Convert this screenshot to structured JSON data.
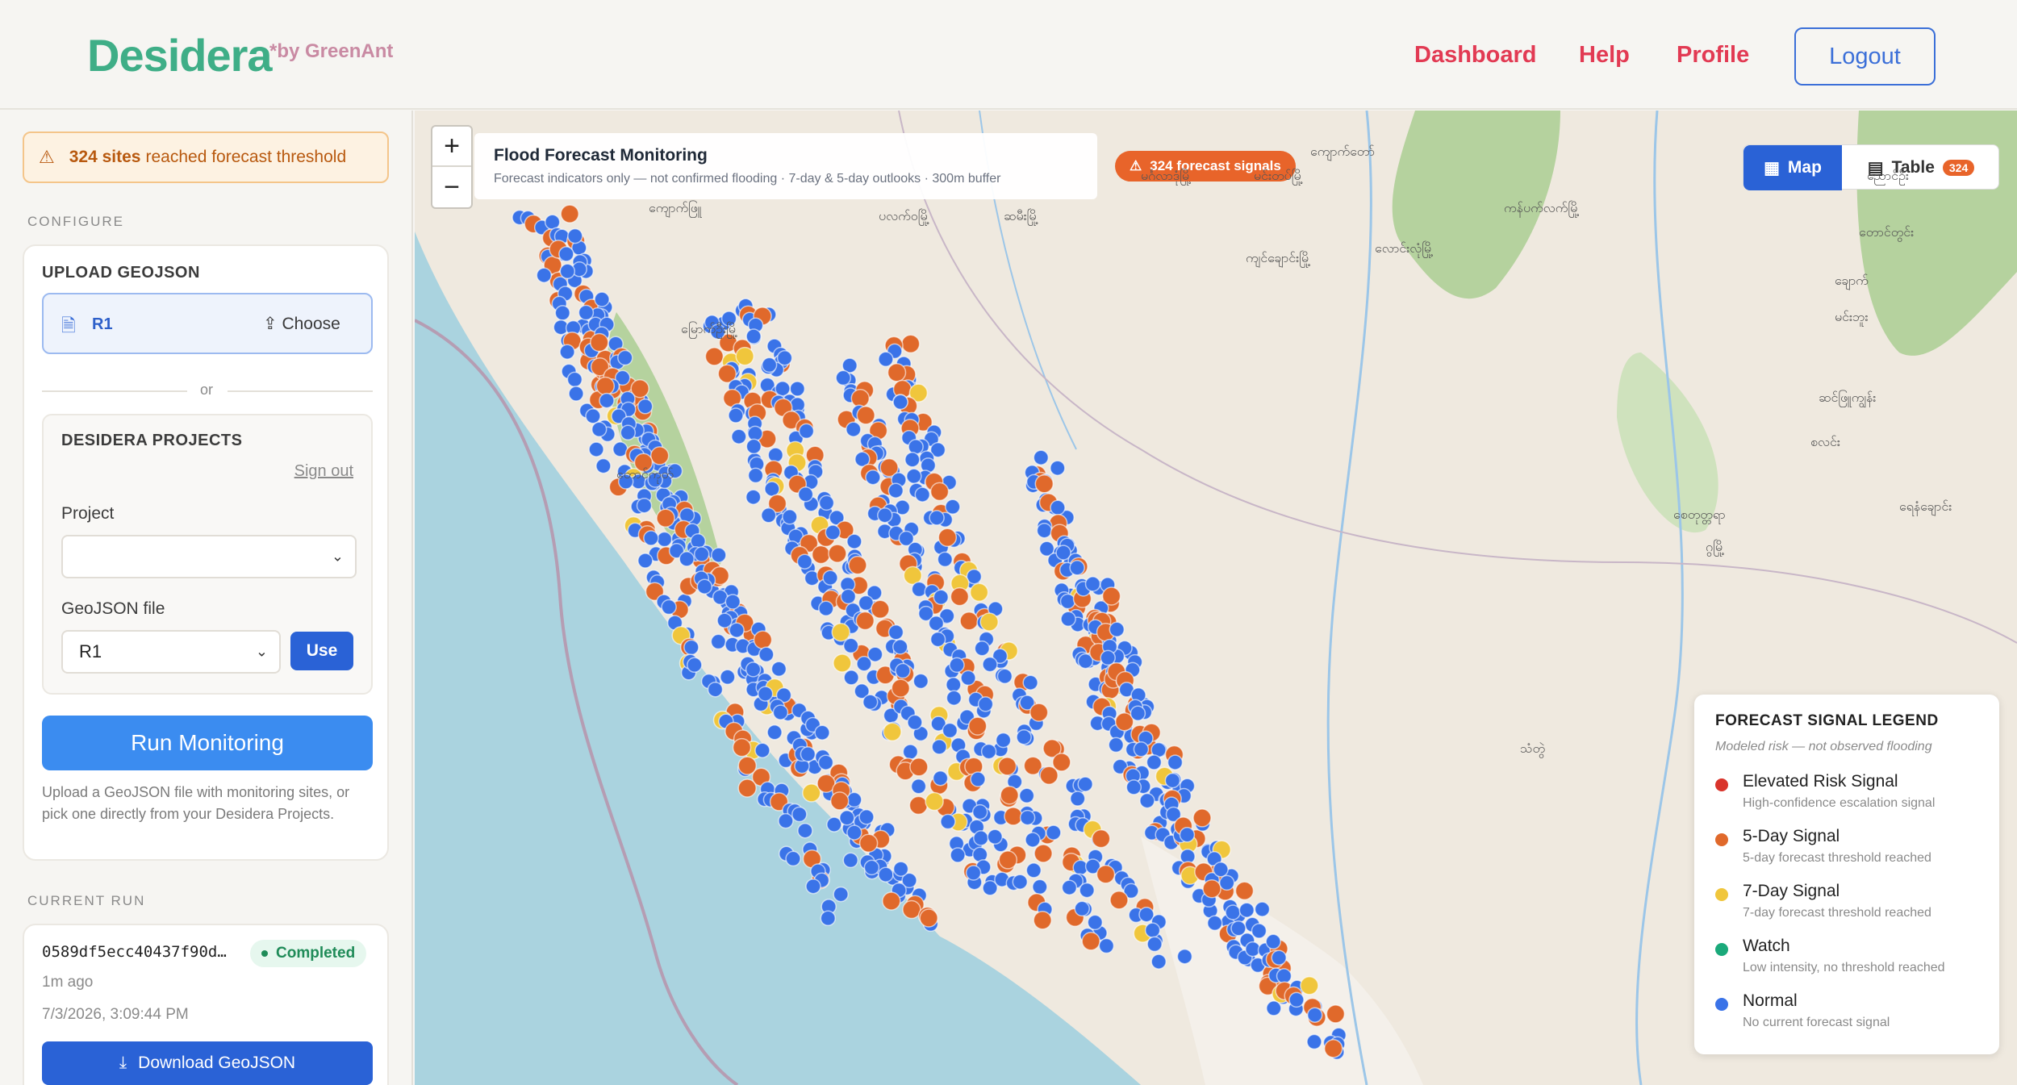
{
  "header": {
    "logo": "Desidera",
    "logo_sub": "*by GreenAnt",
    "nav": [
      "Dashboard",
      "Help",
      "Profile"
    ],
    "logout": "Logout"
  },
  "sidebar": {
    "alert": {
      "icon": "warning-icon",
      "count_text": "324 sites",
      "text": "reached forecast threshold"
    },
    "configure_label": "CONFIGURE",
    "upload": {
      "title": "UPLOAD GEOJSON",
      "file_name": "R1",
      "choose_label": "Choose",
      "or_label": "or"
    },
    "projects": {
      "title": "DESIDERA PROJECTS",
      "sign_out": "Sign out",
      "project_label": "Project",
      "project_value": "",
      "geojson_label": "GeoJSON file",
      "geojson_value": "R1",
      "use_label": "Use"
    },
    "run_button": "Run Monitoring",
    "help_text": "Upload a GeoJSON file with monitoring sites, or pick one directly from your Desidera Projects.",
    "current_run_label": "CURRENT RUN",
    "current_run": {
      "id": "0589df5ecc40437f90d…",
      "status": "Completed",
      "ago": "1m ago",
      "timestamp": "7/3/2026, 3:09:44 PM",
      "download_label": "Download GeoJSON"
    }
  },
  "map": {
    "title": "Flood Forecast Monitoring",
    "subtitle": "Forecast indicators only — not confirmed flooding · 7-day & 5-day outlooks · 300m buffer",
    "signals_pill": "324 forecast signals",
    "zoom_in": "+",
    "zoom_out": "−",
    "view_map": "Map",
    "view_table": "Table",
    "table_count": "324",
    "colors": {
      "elevated": "#d9342b",
      "five_day": "#e0692b",
      "seven_day": "#f0c63c",
      "watch": "#1aa97a",
      "normal": "#3a73e8"
    },
    "place_labels": [
      "ကျောက်တော်",
      "မင်းတပ်မြို့",
      "ပလက်ဝမြို့",
      "ဆမီးမြို့",
      "မင်္ဂလာဒုံမြို့",
      "ကျင်ချောင်းမြို့",
      "လောင်းလုံမြို့",
      "ကန်ပက်လက်မြို့",
      "ညောင်ဦး",
      "တောင်တွင်း",
      "ချောက်",
      "မင်းဘူး",
      "ဆင်ဖြူကျွန်း",
      "စလင်း",
      "စေတုတ္တရာ",
      "ရေနံချောင်း",
      "မြောက်ဦးမြို့",
      "ကျောက်ဖြူ",
      "တောင်ကုတ်",
      "ဂွမြို့",
      "သံတွဲ"
    ]
  },
  "legend": {
    "title": "FORECAST SIGNAL LEGEND",
    "subtitle": "Modeled risk — not observed flooding",
    "items": [
      {
        "name": "Elevated Risk Signal",
        "desc": "High-confidence escalation signal"
      },
      {
        "name": "5-Day Signal",
        "desc": "5-day forecast threshold reached"
      },
      {
        "name": "7-Day Signal",
        "desc": "7-day forecast threshold reached"
      },
      {
        "name": "Watch",
        "desc": "Low intensity, no threshold reached"
      },
      {
        "name": "Normal",
        "desc": "No current forecast signal"
      }
    ]
  }
}
